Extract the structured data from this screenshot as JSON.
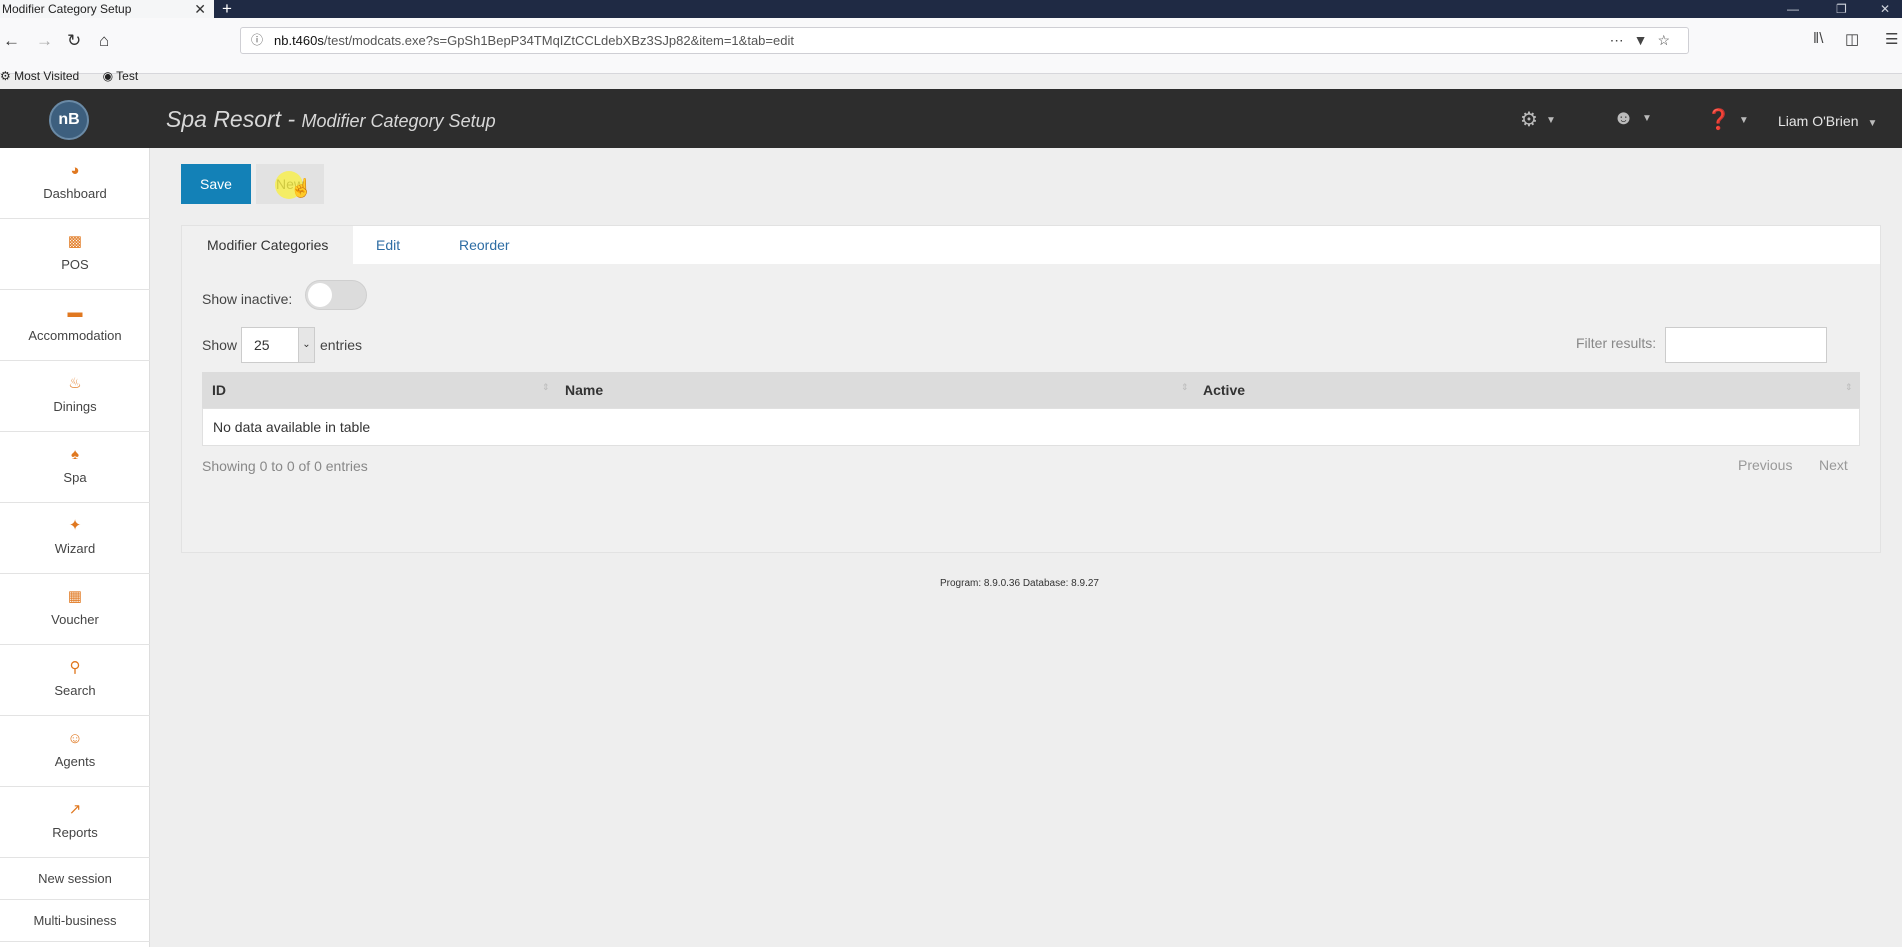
{
  "browser": {
    "tab_title": "Modifier Category Setup",
    "tab_close": "✕",
    "new_tab": "+",
    "url_host": "nb.t460s",
    "url_path": "/test/modcats.exe?s=GpSh1BepP34TMqIZtCCLdebXBz3SJp82&item=1&tab=edit",
    "bookmarks": [
      "Most Visited",
      "Test"
    ]
  },
  "header": {
    "logo": "nB",
    "title_main": "Spa Resort - ",
    "title_sub": "Modifier Category Setup",
    "user": "Liam O'Brien"
  },
  "sidebar": {
    "items": [
      {
        "label": "Dashboard",
        "icon": "dashboard-icon"
      },
      {
        "label": "POS",
        "icon": "pos-icon"
      },
      {
        "label": "Accommodation",
        "icon": "bed-icon"
      },
      {
        "label": "Dinings",
        "icon": "dining-icon"
      },
      {
        "label": "Spa",
        "icon": "spa-icon"
      },
      {
        "label": "Wizard",
        "icon": "wand-icon"
      },
      {
        "label": "Voucher",
        "icon": "gift-icon"
      },
      {
        "label": "Search",
        "icon": "search-icon"
      },
      {
        "label": "Agents",
        "icon": "agent-icon"
      },
      {
        "label": "Reports",
        "icon": "chart-icon"
      }
    ],
    "new_session": "New session",
    "multi_business": "Multi-business"
  },
  "toolbar": {
    "save_label": "Save",
    "new_label": "New"
  },
  "panel": {
    "tabs": [
      "Modifier Categories",
      "Edit",
      "Reorder"
    ],
    "active_tab": "Modifier Categories",
    "show_inactive_label": "Show inactive:",
    "show_inactive": false,
    "show_label": "Show",
    "entries_value": "25",
    "entries_label": "entries",
    "filter_label": "Filter results:",
    "filter_value": "",
    "columns": [
      "ID",
      "Name",
      "Active"
    ],
    "empty_message": "No data available in table",
    "info": "Showing 0 to 0 of 0 entries",
    "previous": "Previous",
    "next": "Next"
  },
  "footer": "Program: 8.9.0.36 Database: 8.9.27"
}
